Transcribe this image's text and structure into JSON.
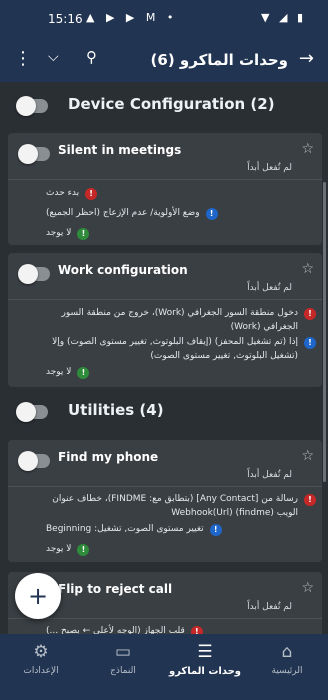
{
  "status_bar": {
    "time": "15:16",
    "left_icons": "▲ ▶ ▶ M •",
    "right_icons": "▼ ◢ ▮"
  },
  "app_bar": {
    "title": "وحدات الماكرو (6)",
    "back_glyph": "→",
    "menu_glyph": "⋮",
    "collapse_glyph": "⌵",
    "search_glyph": "⚲"
  },
  "groups": [
    {
      "label": "Device Configuration (2)"
    },
    {
      "label": "Utilities (4)"
    }
  ],
  "never_fired": "لم تُفعل أبداً",
  "cards": [
    {
      "name": "Silent in meetings",
      "rows": [
        "بدء حدث",
        "وضع الأولوية/ عدم الإزعاج (احظر الجميع)",
        "لا يوجد"
      ]
    },
    {
      "name": "Work configuration",
      "rows": [
        "دخول منطقة السور الجغرافي (Work)، خروج من منطقة السور الجغرافي (Work)",
        "إذا (تم تشغيل المحفز) (إيقاف البلوتوث, تغيير مستوى الصوت) وإلا (تشغيل البلوتوث, تغيير مستوى الصوت)",
        "لا يوجد"
      ]
    },
    {
      "name": "Find my phone",
      "rows": [
        "رسالة من [Any Contact] (بتطابق مع: FINDME)، خطاف عنوان الويب Webhook(Url) (findme)",
        "تغيير مستوى الصوت, تشغيل: Beginning",
        "لا يوجد"
      ]
    },
    {
      "name": "Flip to reject call",
      "rows": [
        "قلب الجهاز (الوجه لأعلى ← بصبح ...)"
      ]
    }
  ],
  "fab_glyph": "+",
  "nav": [
    {
      "label": "الإعدادات",
      "icon": "⚙"
    },
    {
      "label": "النماذج",
      "icon": "▭"
    },
    {
      "label": "وحدات الماكرو",
      "icon": "☰"
    },
    {
      "label": "الرئيسية",
      "icon": "⌂"
    }
  ],
  "colors": {
    "primary": "#213451",
    "background": "#2a2f34",
    "card": "#3a3f44",
    "trigger": "#c62828",
    "action": "#1e66c9",
    "constraint": "#2e8b3a"
  }
}
